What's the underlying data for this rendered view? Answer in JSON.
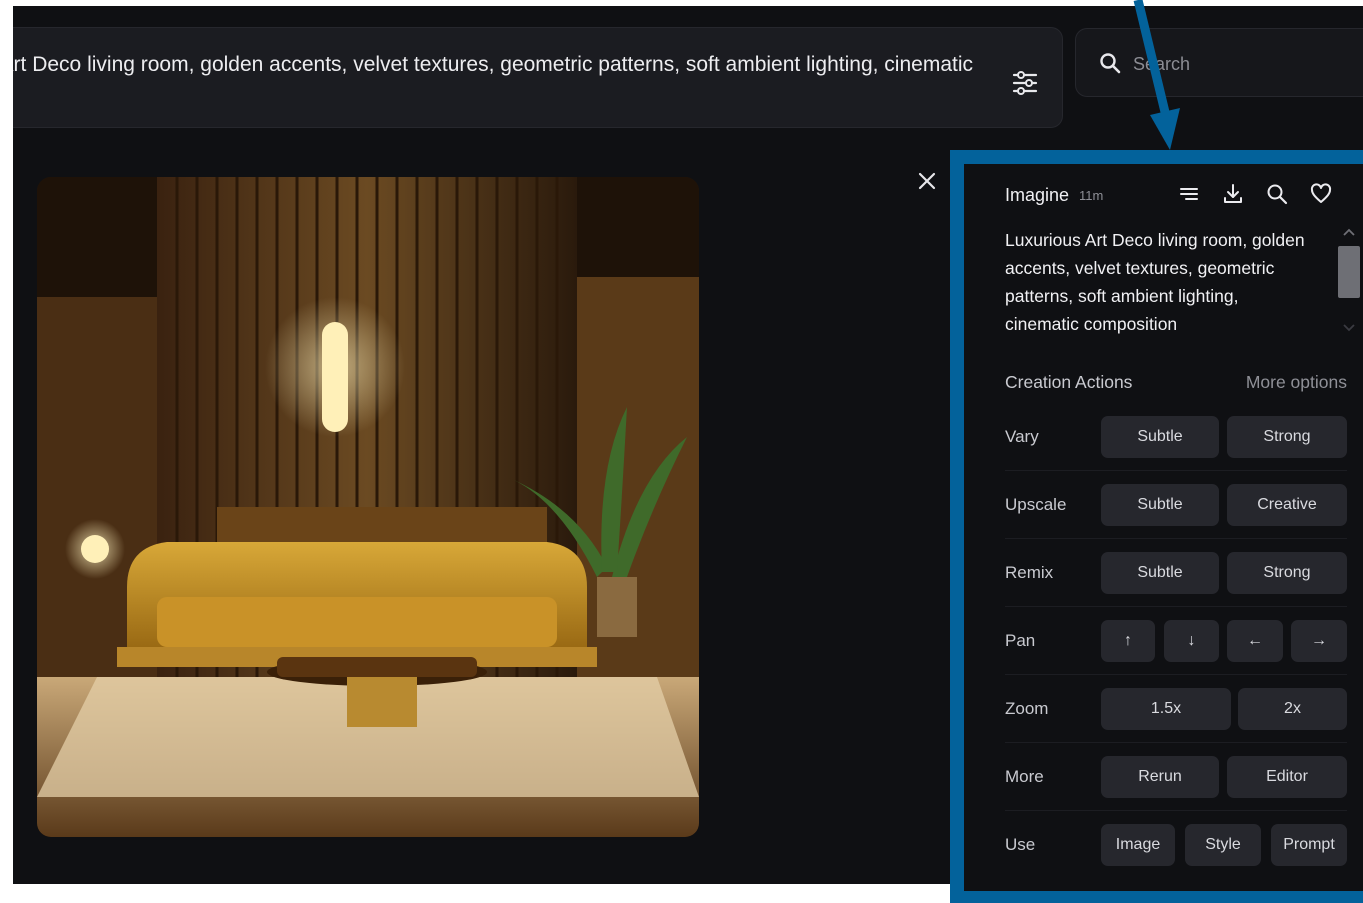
{
  "prompt_bar": {
    "text": "Luxurious Art Deco living room, golden accents, velvet textures, geometric patterns, soft ambient lighting, cinematic"
  },
  "search": {
    "placeholder": "Search"
  },
  "panel": {
    "title": "Imagine",
    "time": "11m",
    "description": "Luxurious Art Deco living room, golden accents, velvet textures, geometric patterns, soft ambient lighting, cinematic composition",
    "section_title": "Creation Actions",
    "more_options": "More options",
    "rows": [
      {
        "label": "Vary",
        "buttons": [
          "Subtle",
          "Strong"
        ]
      },
      {
        "label": "Upscale",
        "buttons": [
          "Subtle",
          "Creative"
        ]
      },
      {
        "label": "Remix",
        "buttons": [
          "Subtle",
          "Strong"
        ]
      },
      {
        "label": "Pan",
        "buttons": [
          "↑",
          "↓",
          "←",
          "→"
        ]
      },
      {
        "label": "Zoom",
        "buttons": [
          "1.5x",
          "2x"
        ]
      },
      {
        "label": "More",
        "buttons": [
          "Rerun",
          "Editor"
        ]
      },
      {
        "label": "Use",
        "buttons": [
          "Image",
          "Style",
          "Prompt"
        ]
      }
    ]
  },
  "colors": {
    "background": "#0f1013",
    "highlight_border": "#03629b",
    "button": "#26272d"
  }
}
